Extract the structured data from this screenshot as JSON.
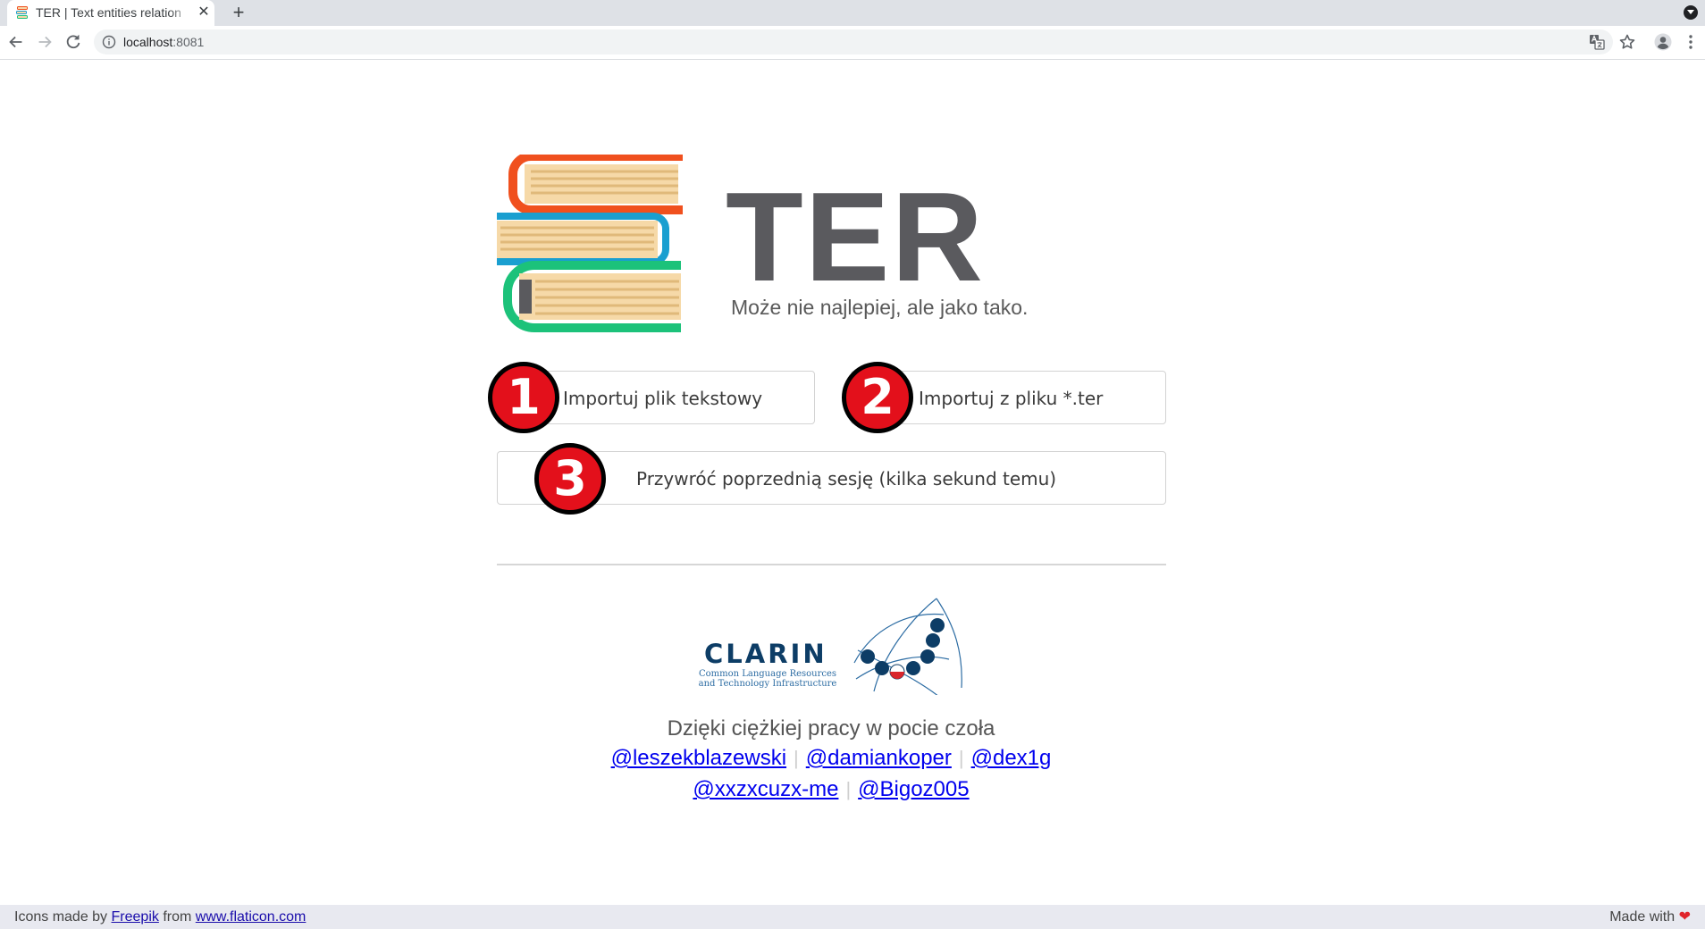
{
  "browser": {
    "tab_title": "TER | Text entities relation",
    "tab_close": "✕",
    "new_tab": "+",
    "url_host": "localhost",
    "url_port": ":8081"
  },
  "app": {
    "title": "TER",
    "tagline": "Może nie najlepiej, ale jako tako."
  },
  "actions": {
    "import_text": {
      "number": "1",
      "label": "Importuj plik tekstowy"
    },
    "import_ter": {
      "number": "2",
      "label": "Importuj z pliku *.ter"
    },
    "restore_session": {
      "number": "3",
      "label": "Przywróć poprzednią sesję (kilka sekund temu)"
    }
  },
  "clarin": {
    "wordmark": "CLARIN",
    "subtitle": "Common Language Resources and Technology Infrastructure"
  },
  "credits": {
    "line": "Dzięki ciężkiej pracy w pocie czoła",
    "authors_row1": [
      "@leszekblazewski",
      "@damiankoper",
      "@dex1g"
    ],
    "authors_row2": [
      "@xxzxcuzx-me",
      "@Bigoz005"
    ]
  },
  "footer": {
    "icons_prefix": "Icons made by",
    "freepik": "Freepik",
    "from": "from",
    "flaticon": "www.flaticon.com",
    "made_with": "Made with",
    "heart": "❤"
  },
  "colors": {
    "book_top": "#f0501e",
    "book_middle": "#1a9fd0",
    "book_bottom": "#1cc27a",
    "badge_red": "#e3101b",
    "title_gray": "#5a5a5e",
    "clarin_navy": "#0d3d66"
  }
}
